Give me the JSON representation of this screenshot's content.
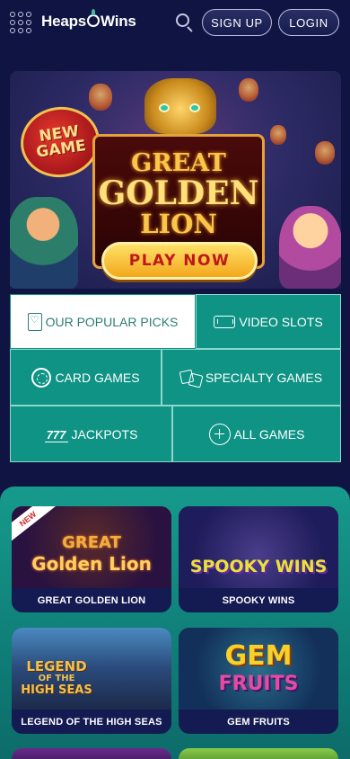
{
  "header": {
    "logo_text_left": "Heaps",
    "logo_text_right": "Wins",
    "signup_label": "SIGN UP",
    "login_label": "LOGIN"
  },
  "hero": {
    "badge_line1": "NEW",
    "badge_line2": "GAME",
    "title_line1": "GREAT",
    "title_line2": "GOLDEN",
    "title_line3": "LION",
    "cta_label": "PLAY NOW"
  },
  "categories": [
    {
      "label": "OUR POPULAR PICKS",
      "icon": "heart-card-icon",
      "active": true
    },
    {
      "label": "VIDEO SLOTS",
      "icon": "slot-machine-icon",
      "active": false
    },
    {
      "label": "CARD GAMES",
      "icon": "poker-chip-icon",
      "active": false
    },
    {
      "label": "SPECIALTY GAMES",
      "icon": "dice-icon",
      "active": false
    },
    {
      "label": "JACKPOTS",
      "icon": "jackpot-777-icon",
      "jackpot_glyph": "777",
      "active": false
    },
    {
      "label": "ALL GAMES",
      "icon": "plus-circle-icon",
      "active": false
    }
  ],
  "games": [
    {
      "title": "GREAT GOLDEN LION",
      "art_text_line1": "GREAT",
      "art_text_line2": "Golden Lion",
      "tag": "NEW"
    },
    {
      "title": "SPOOKY WINS",
      "art_text_line1": "SPOOKY WINS"
    },
    {
      "title": "LEGEND OF THE HIGH SEAS",
      "art_text_line1": "LEGEND",
      "art_text_line2": "OF THE",
      "art_text_line3": "HIGH SEAS"
    },
    {
      "title": "GEM FRUITS",
      "art_text_line1": "GEM",
      "art_text_line2": "FRUITS"
    }
  ],
  "colors": {
    "background": "#0f1442",
    "teal": "#0e9384",
    "cta_gold": "#f2a81c",
    "cta_text": "#c0171c"
  }
}
